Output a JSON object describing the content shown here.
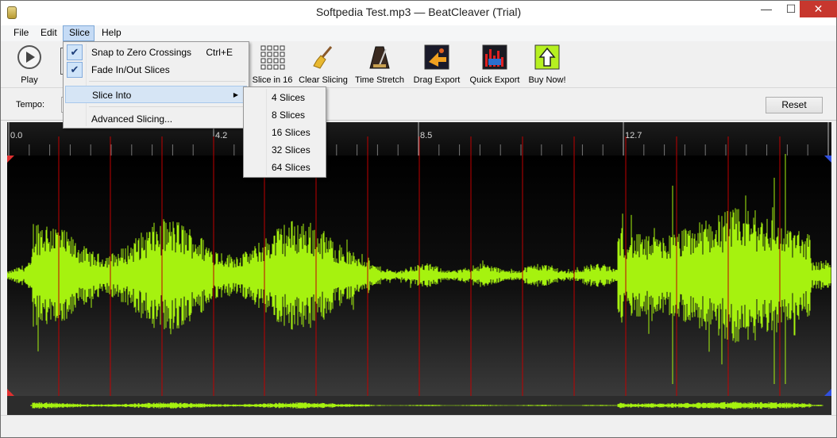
{
  "window": {
    "title": "Softpedia Test.mp3 — BeatCleaver (Trial)",
    "minimize": "—",
    "maximize": "☐",
    "close": "✕"
  },
  "menubar": {
    "items": [
      {
        "label": "File"
      },
      {
        "label": "Edit"
      },
      {
        "label": "Slice"
      },
      {
        "label": "Help"
      }
    ]
  },
  "toolbar": {
    "play": "Play",
    "slice16": "Slice in 16",
    "clear": "Clear Slicing",
    "stretch": "Time Stretch",
    "drag": "Drag Export",
    "quick": "Quick Export",
    "buy": "Buy Now!"
  },
  "tempo": {
    "label": "Tempo:",
    "value": "",
    "reset": "Reset"
  },
  "slice_menu": {
    "snap": {
      "label": "Snap to Zero Crossings",
      "shortcut": "Ctrl+E",
      "checked": true
    },
    "fade": {
      "label": "Fade In/Out Slices",
      "checked": true
    },
    "slice_into": "Slice Into",
    "advanced": "Advanced Slicing..."
  },
  "slice_into_submenu": [
    "4 Slices",
    "8 Slices",
    "16 Slices",
    "32 Slices",
    "64 Slices"
  ],
  "timeline": {
    "ticks": [
      "0.0",
      "4.2",
      "8.5",
      "12.7"
    ]
  },
  "waveform": {
    "wave_color": "#a6f20f",
    "slice_color": "#c00000",
    "background": "#000000",
    "slice_count": 16
  }
}
